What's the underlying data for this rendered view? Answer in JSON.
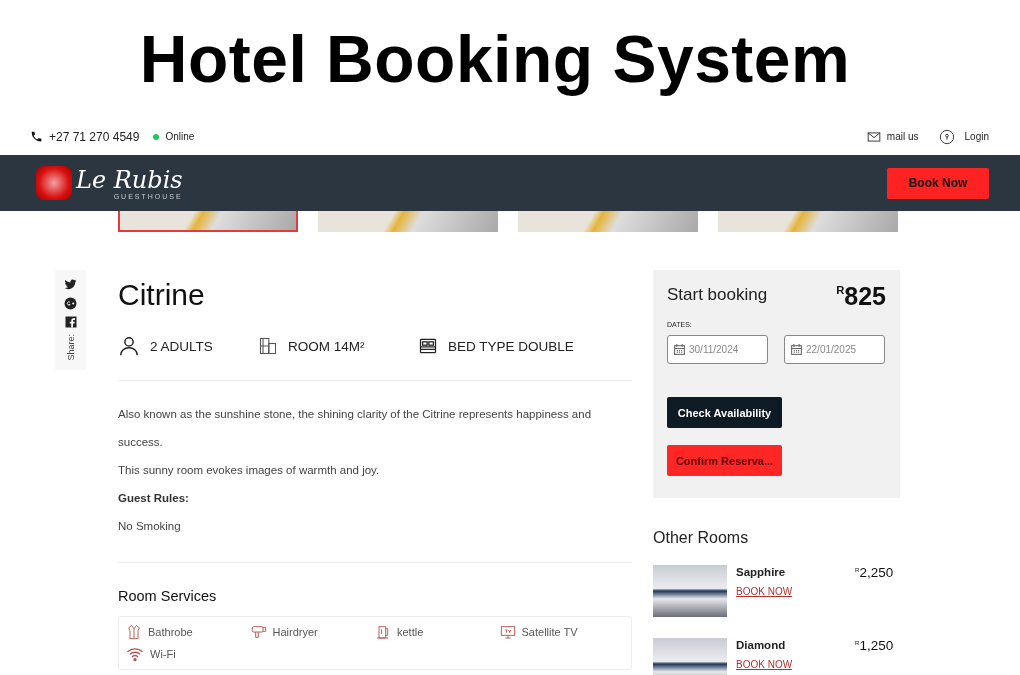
{
  "banner": {
    "title": "Hotel Booking System"
  },
  "topbar": {
    "phone": "+27 71 270 4549",
    "status": "Online",
    "mail": "mail us",
    "login": "Login"
  },
  "nav": {
    "logo": "Le Rubis",
    "logo_sub": "GUESTHOUSE",
    "button": "Book Now"
  },
  "gallery": [
    {
      "selected": true
    },
    {
      "selected": false
    },
    {
      "selected": false
    },
    {
      "selected": false
    }
  ],
  "share": {
    "label": "Share:",
    "icons": [
      {
        "kind": "twitter"
      },
      {
        "kind": "gplus"
      },
      {
        "kind": "facebook"
      }
    ]
  },
  "room": {
    "name": "Citrine",
    "features": [
      {
        "kind": "guests",
        "label": "2 ADULTS"
      },
      {
        "kind": "size",
        "label": "ROOM 14M²"
      },
      {
        "kind": "bed",
        "label": "BED TYPE DOUBLE"
      }
    ],
    "description": [
      "Also known as the sunshine stone, the shining clarity of the Citrine represents happiness and success.",
      "This sunny room evokes images of warmth and joy."
    ],
    "rules_title": "Guest Rules:",
    "rules": [
      "No Smoking"
    ],
    "services_title": "Room Services",
    "services": [
      {
        "kind": "bathrobe",
        "label": "Bathrobe"
      },
      {
        "kind": "hairdryer",
        "label": "Hairdryer"
      },
      {
        "kind": "kettle",
        "label": "kettle"
      },
      {
        "kind": "tv",
        "label": "Satellite TV"
      },
      {
        "kind": "wifi",
        "label": "Wi-Fi"
      }
    ]
  },
  "booking": {
    "title": "Start booking",
    "price": "$^{R}$825",
    "dates_label": "DATES:",
    "check_in": "30/11/2024",
    "check_out": "22/01/2025",
    "check_button": "Check Availability",
    "confirm_button": "Confirm Reserva..."
  },
  "other_rooms": {
    "title": "Other Rooms",
    "rooms": [
      {
        "name": "Sapphire",
        "price": "$^{R}$2,250",
        "link": "BOOK NOW"
      },
      {
        "name": "Diamond",
        "price": "$^{R}$1,250",
        "link": "BOOK NOW"
      }
    ]
  }
}
